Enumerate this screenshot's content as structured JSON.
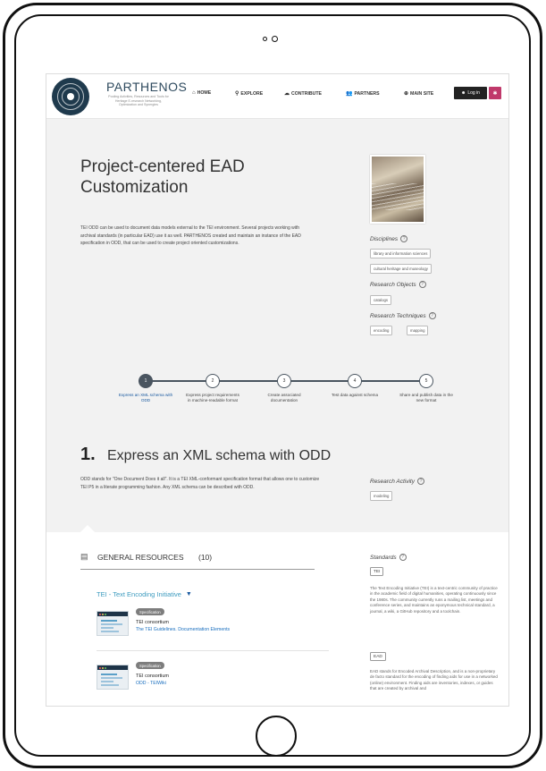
{
  "header": {
    "brand": "PARTHENOS",
    "tagline": "Pooling Activities, Resources and Tools for Heritage E-research Networking, Optimization and Synergies",
    "nav": [
      {
        "icon": "home-icon",
        "glyph": "⌂",
        "label": "HOME"
      },
      {
        "icon": "search-icon",
        "glyph": "⚲",
        "label": "EXPLORE"
      },
      {
        "icon": "cloud-upload-icon",
        "glyph": "☁",
        "label": "CONTRIBUTE"
      },
      {
        "icon": "users-icon",
        "glyph": "👥",
        "label": "PARTNERS"
      },
      {
        "icon": "globe-icon",
        "glyph": "⊕",
        "label": "MAIN SITE"
      }
    ],
    "login_label": "Log in",
    "flag_icon": "eu-flag-icon"
  },
  "hero": {
    "title": "Project-centered EAD Customization",
    "intro": "TEI ODD can be used to document data models external to the TEI environment. Several projects working with archival standards (in particular EAD) use it as well. PARTHENOS created and maintain an instance of the EAD specification in ODD, that can be used to create project oriented customizations."
  },
  "sidebar": {
    "disciplines_label": "Disciplines",
    "disciplines": [
      "library and information sciences",
      "cultural heritage and museology"
    ],
    "research_objects_label": "Research Objects",
    "research_objects": [
      "catalogs"
    ],
    "research_techniques_label": "Research Techniques",
    "research_techniques": [
      "encoding",
      "mapping"
    ]
  },
  "steps": [
    {
      "number": "1",
      "label": "Express an XML schema with ODD",
      "active": true
    },
    {
      "number": "2",
      "label": "Express project requirements in machine-readable format",
      "active": false
    },
    {
      "number": "3",
      "label": "Create associated documentation",
      "active": false
    },
    {
      "number": "4",
      "label": "Test data against schema",
      "active": false
    },
    {
      "number": "5",
      "label": "Share and publish data in the new format",
      "active": false
    }
  ],
  "section": {
    "number": "1.",
    "title": "Express an XML schema with ODD",
    "description": "ODD stands for \"One Document Does it all\". It is a TEI XML-conformant specification format that allows one to customize TEI P5 in a literate programming fashion. Any XML schema can be described with ODD.",
    "research_activity_label": "Research Activity",
    "research_activity": [
      "modeling"
    ]
  },
  "resources": {
    "title": "GENERAL RESOURCES",
    "count": "(10)",
    "group_title": "TEI - Text Encoding Initiative",
    "items": [
      {
        "badge": "Specification",
        "name": "TEI consortium",
        "link": "The TEI Guidelines. Documentation Elements"
      },
      {
        "badge": "Specification",
        "name": "TEI consortium",
        "link": "ODD - TEIWiki"
      }
    ]
  },
  "standards": {
    "label": "Standards",
    "items": [
      {
        "tag": "TEI",
        "desc": "The Text Encoding Initiative (TEI) is a text-centric community of practice in the academic field of digital humanities, operating continuously since the 1980s. The community currently runs a mailing list, meetings and conference series, and maintains an eponymous technical standard, a journal, a wiki, a GitHub repository and a toolchain."
      },
      {
        "tag": "EAD",
        "desc": "EAD stands for Encoded Archival Description, and is a non-proprietary de facto standard for the encoding of finding aids for use in a networked (online) environment. Finding aids are inventories, indexes, or guides that are created by archival and"
      }
    ]
  },
  "colors": {
    "logo": "#1f3a4d",
    "step_line": "#4a5560",
    "link": "#1a6fbf",
    "group_title": "#3d9bbf"
  }
}
